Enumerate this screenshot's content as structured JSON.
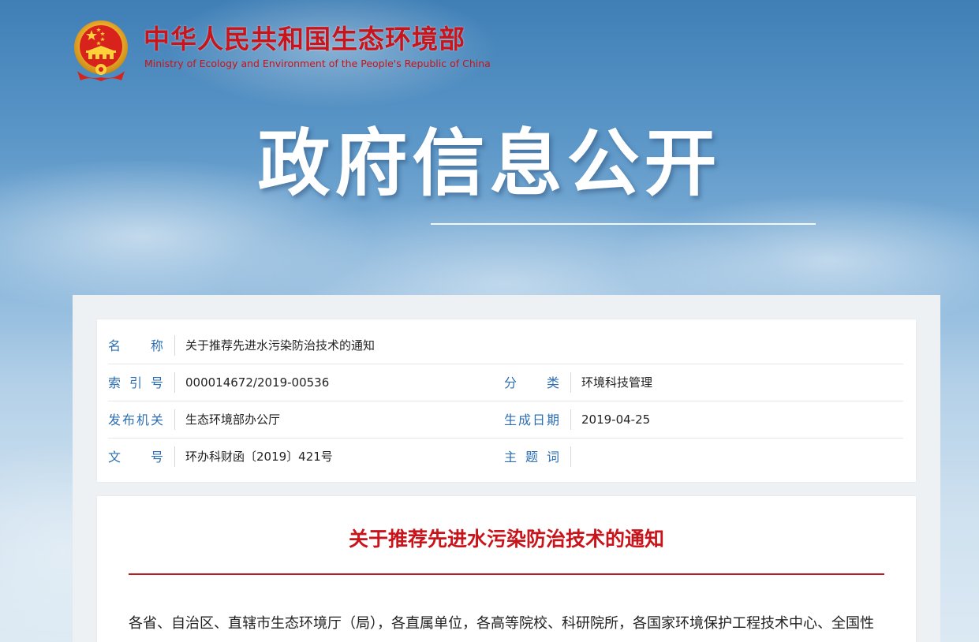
{
  "header": {
    "emblem_icon": "national-emblem-icon",
    "ministry_cn": "中华人民共和国生态环境部",
    "ministry_en": "Ministry of Ecology and Environment of the People's Republic of China"
  },
  "banner": {
    "title": "政府信息公开"
  },
  "meta": {
    "name_label": "名　　称",
    "name_value": "关于推荐先进水污染防治技术的通知",
    "index_label": "索 引 号",
    "index_value": "000014672/2019-00536",
    "category_label": "分　　类",
    "category_value": "环境科技管理",
    "issuer_label": "发布机关",
    "issuer_value": "生态环境部办公厅",
    "date_label": "生成日期",
    "date_value": "2019-04-25",
    "doc_no_label": "文　　号",
    "doc_no_value": "环办科财函〔2019〕421号",
    "keywords_label": "主 题 词",
    "keywords_value": ""
  },
  "article": {
    "title": "关于推荐先进水污染防治技术的通知",
    "body_first_line": "各省、自治区、直辖市生态环境厅（局），各直属单位，各高等院校、科研院所，各国家环境保护工程技术中心、全国性"
  },
  "colors": {
    "brand_red": "#c8141a",
    "label_blue": "#2d6fb3"
  }
}
